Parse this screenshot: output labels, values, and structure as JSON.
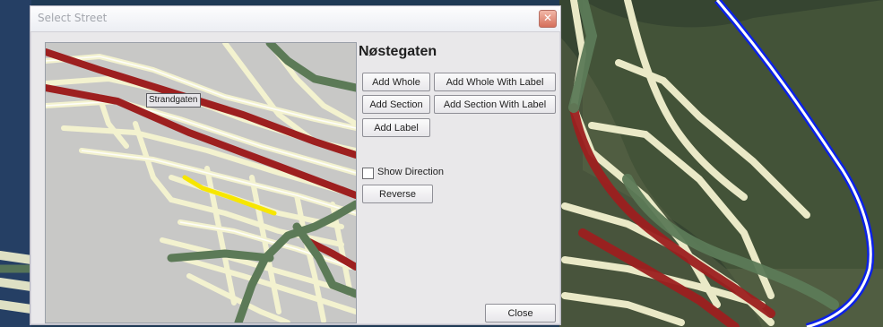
{
  "dialog": {
    "title": "Select Street",
    "street_name": "Nøstegaten",
    "buttons": {
      "add_whole": "Add Whole",
      "add_whole_with_label": "Add Whole With Label",
      "add_section": "Add Section",
      "add_section_with_label": "Add Section With Label",
      "add_label": "Add Label",
      "reverse": "Reverse",
      "close": "Close"
    },
    "show_direction": {
      "label": "Show Direction",
      "checked": false
    },
    "map_label": "Strandgaten"
  },
  "colors": {
    "street_base": "#f3f2cf",
    "major_road": "#9d1f1f",
    "green_road": "#5c7a57",
    "selected_segment": "#f7e600",
    "blue_route": "#0b21e6"
  }
}
